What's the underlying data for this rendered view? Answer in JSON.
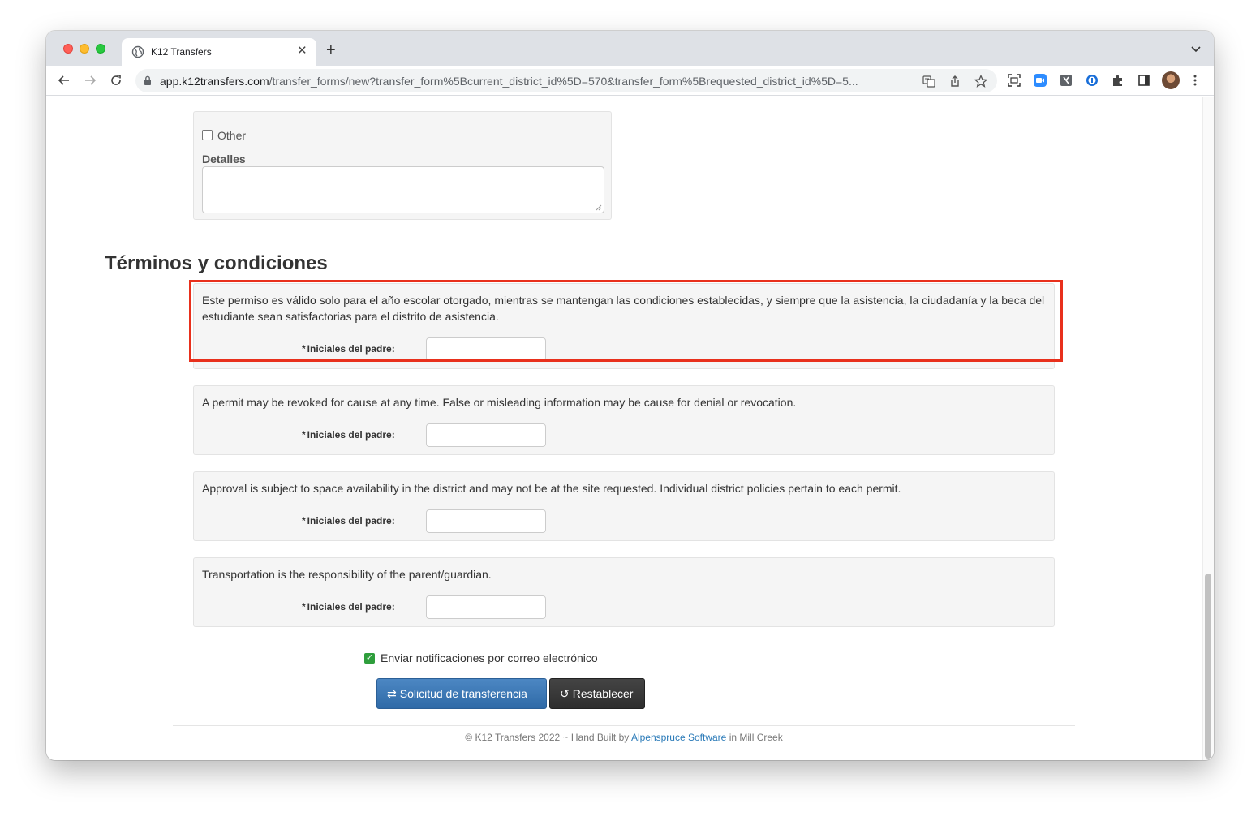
{
  "browser": {
    "tab_title": "K12 Transfers",
    "new_tab": "+",
    "tab_close": "✕",
    "url_host": "app.k12transfers.com",
    "url_path": "/transfer_forms/new?transfer_form%5Bcurrent_district_id%5D=570&transfer_form%5Brequested_district_id%5D=5..."
  },
  "form": {
    "other_label": "Other",
    "details_label": "Detalles",
    "terms_heading": "Términos y condiciones",
    "required_mark": "*",
    "initials_label": "Iniciales del padre:",
    "terms": [
      {
        "text": "Este permiso es válido solo para el año escolar otorgado, mientras se mantengan las condiciones establecidas, y siempre que la asistencia, la ciudadanía y la beca del estudiante sean satisfactorias para el distrito de asistencia."
      },
      {
        "text": "A permit may be revoked for cause at any time. False or misleading information may be cause for denial or revocation."
      },
      {
        "text": "Approval is subject to space availability in the district and may not be at the site requested. Individual district policies pertain to each permit."
      },
      {
        "text": "Transportation is the responsibility of the parent/guardian."
      }
    ],
    "notify_label": "Enviar notificaciones por correo electrónico",
    "notify_checked": true,
    "submit_label": "Solicitud de transferencia",
    "reset_label": "Restablecer"
  },
  "footer": {
    "prefix": "© K12 Transfers 2022 ~ Hand Built by",
    "link_text": "Alpenspruce Software",
    "suffix": "in Mill Creek"
  },
  "colors": {
    "highlight": "#e8301c",
    "primary_button": "#3a75b3",
    "secondary_button": "#333333",
    "link": "#2a7ab8",
    "check_green": "#2e9e3c"
  }
}
